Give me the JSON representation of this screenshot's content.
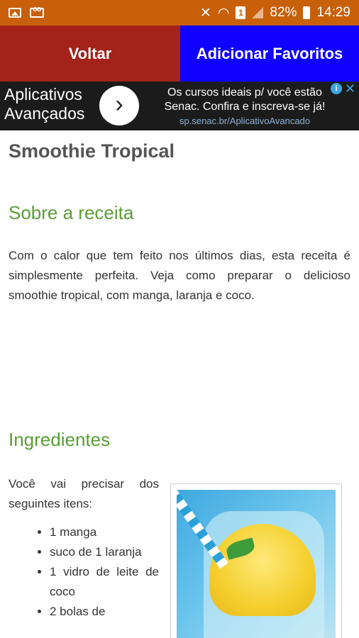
{
  "status_bar": {
    "battery": "82%",
    "time": "14:29",
    "sim": "1"
  },
  "toolbar": {
    "back_label": "Voltar",
    "favorite_label": "Adicionar Favoritos"
  },
  "ad": {
    "title_line1": "Aplicativos",
    "title_line2": "Avançados",
    "arrow": "›",
    "text_line1": "Os cursos ideais p/ você estão",
    "text_line2": "Senac. Confira e inscreva-se já!",
    "url": "sp.senac.br/AplicativoAvancado",
    "info": "i",
    "close": "✕"
  },
  "recipe": {
    "title": "Smoothie Tropical",
    "about_heading": "Sobre a receita",
    "about_text": "Com o calor que tem feito nos últimos dias, esta receita é simplesmente perfeita. Veja como preparar o delicioso smoothie tropical, com manga, laranja e coco.",
    "ingredients_heading": "Ingredientes",
    "ingredients_intro": "Você vai precisar dos seguintes itens:",
    "ingredients": [
      "1 manga",
      "suco de 1 laranja",
      "1 vidro de leite de coco",
      "2 bolas de"
    ]
  }
}
